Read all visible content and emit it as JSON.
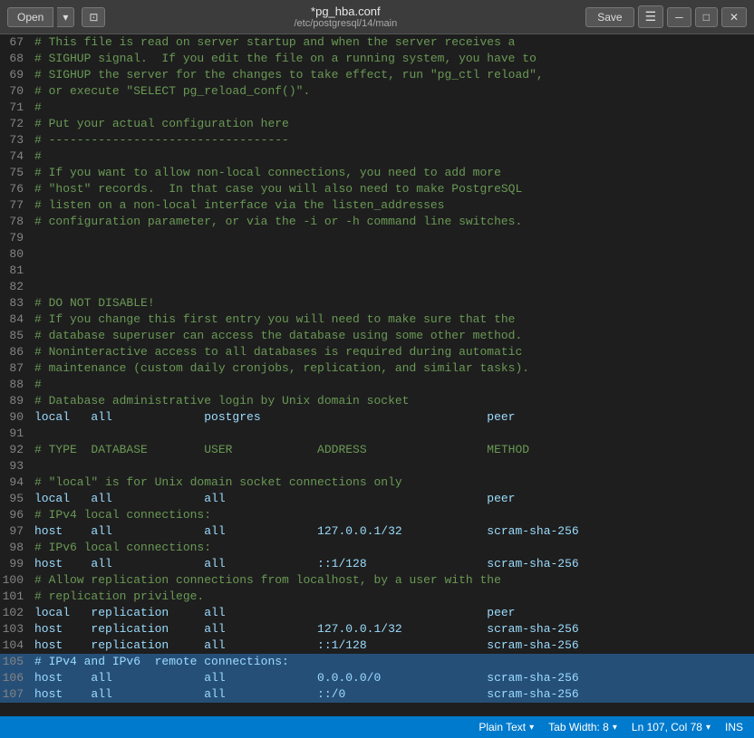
{
  "titlebar": {
    "open_label": "Open",
    "dropdown_icon": "▾",
    "save_icon_label": "⊡",
    "filename": "*pg_hba.conf",
    "filepath": "/etc/postgresql/14/main",
    "save_label": "Save",
    "menu_icon": "☰",
    "minimize_icon": "─",
    "maximize_icon": "□",
    "close_icon": "✕"
  },
  "statusbar": {
    "plain_text_label": "Plain Text",
    "tab_width_label": "Tab Width: 8",
    "position_label": "Ln 107, Col 78",
    "ins_label": "INS"
  },
  "lines": [
    {
      "num": 67,
      "content": "# This file is read on server startup and when the server receives a",
      "type": "comment"
    },
    {
      "num": 68,
      "content": "# SIGHUP signal.  If you edit the file on a running system, you have to",
      "type": "comment"
    },
    {
      "num": 69,
      "content": "# SIGHUP the server for the changes to take effect, run \"pg_ctl reload\",",
      "type": "comment"
    },
    {
      "num": 70,
      "content": "# or execute \"SELECT pg_reload_conf()\".",
      "type": "comment"
    },
    {
      "num": 71,
      "content": "#",
      "type": "comment"
    },
    {
      "num": 72,
      "content": "# Put your actual configuration here",
      "type": "comment"
    },
    {
      "num": 73,
      "content": "# ----------------------------------",
      "type": "comment"
    },
    {
      "num": 74,
      "content": "#",
      "type": "comment"
    },
    {
      "num": 75,
      "content": "# If you want to allow non-local connections, you need to add more",
      "type": "comment"
    },
    {
      "num": 76,
      "content": "# \"host\" records.  In that case you will also need to make PostgreSQL",
      "type": "comment"
    },
    {
      "num": 77,
      "content": "# listen on a non-local interface via the listen_addresses",
      "type": "comment"
    },
    {
      "num": 78,
      "content": "# configuration parameter, or via the -i or -h command line switches.",
      "type": "comment"
    },
    {
      "num": 79,
      "content": "",
      "type": "normal"
    },
    {
      "num": 80,
      "content": "",
      "type": "normal"
    },
    {
      "num": 81,
      "content": "",
      "type": "normal"
    },
    {
      "num": 82,
      "content": "",
      "type": "normal"
    },
    {
      "num": 83,
      "content": "# DO NOT DISABLE!",
      "type": "comment"
    },
    {
      "num": 84,
      "content": "# If you change this first entry you will need to make sure that the",
      "type": "comment"
    },
    {
      "num": 85,
      "content": "# database superuser can access the database using some other method.",
      "type": "comment"
    },
    {
      "num": 86,
      "content": "# Noninteractive access to all databases is required during automatic",
      "type": "comment"
    },
    {
      "num": 87,
      "content": "# maintenance (custom daily cronjobs, replication, and similar tasks).",
      "type": "comment"
    },
    {
      "num": 88,
      "content": "#",
      "type": "comment"
    },
    {
      "num": 89,
      "content": "# Database administrative login by Unix domain socket",
      "type": "comment"
    },
    {
      "num": 90,
      "content": "local   all             postgres                                peer",
      "type": "normal"
    },
    {
      "num": 91,
      "content": "",
      "type": "normal"
    },
    {
      "num": 92,
      "content": "# TYPE  DATABASE        USER            ADDRESS                 METHOD",
      "type": "comment"
    },
    {
      "num": 93,
      "content": "",
      "type": "normal"
    },
    {
      "num": 94,
      "content": "# \"local\" is for Unix domain socket connections only",
      "type": "comment"
    },
    {
      "num": 95,
      "content": "local   all             all                                     peer",
      "type": "normal"
    },
    {
      "num": 96,
      "content": "# IPv4 local connections:",
      "type": "comment"
    },
    {
      "num": 97,
      "content": "host    all             all             127.0.0.1/32            scram-sha-256",
      "type": "normal"
    },
    {
      "num": 98,
      "content": "# IPv6 local connections:",
      "type": "comment"
    },
    {
      "num": 99,
      "content": "host    all             all             ::1/128                 scram-sha-256",
      "type": "normal"
    },
    {
      "num": 100,
      "content": "# Allow replication connections from localhost, by a user with the",
      "type": "comment"
    },
    {
      "num": 101,
      "content": "# replication privilege.",
      "type": "comment"
    },
    {
      "num": 102,
      "content": "local   replication     all                                     peer",
      "type": "normal"
    },
    {
      "num": 103,
      "content": "host    replication     all             127.0.0.1/32            scram-sha-256",
      "type": "normal"
    },
    {
      "num": 104,
      "content": "host    replication     all             ::1/128                 scram-sha-256",
      "type": "normal"
    },
    {
      "num": 105,
      "content": "# IPv4 and IPv6  remote connections:",
      "type": "comment",
      "highlighted": true
    },
    {
      "num": 106,
      "content": "host    all             all             0.0.0.0/0               scram-sha-256",
      "type": "normal",
      "highlighted": true
    },
    {
      "num": 107,
      "content": "host    all             all             ::/0                    scram-sha-256",
      "type": "normal",
      "highlighted": true
    }
  ]
}
